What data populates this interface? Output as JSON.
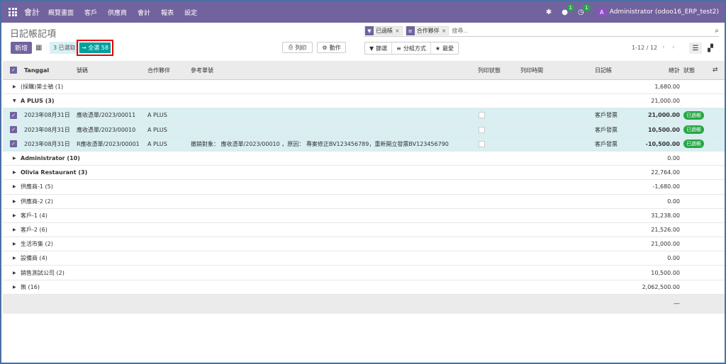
{
  "nav": {
    "brand": "會計",
    "items": [
      "概覽畫面",
      "客戶",
      "供應商",
      "會計",
      "報表",
      "設定"
    ],
    "chat_badge": "1",
    "activity_badge": "1",
    "avatar_letter": "A",
    "user": "Administrator (odoo16_ERP_test2)"
  },
  "page": {
    "title": "日記帳記項"
  },
  "search": {
    "facets": [
      {
        "icon": "filter-icon",
        "label": "已過帳"
      },
      {
        "icon": "layers-icon",
        "label": "合作夥伴"
      }
    ],
    "placeholder": "搜尋..."
  },
  "toolbar": {
    "new_label": "新增",
    "selected_label": "3 已選取",
    "select_all_label": "→ 全選 58",
    "print_label": "列印",
    "action_label": "動作",
    "filter_label": "篩選",
    "groupby_label": "分組方式",
    "favorites_label": "最愛",
    "pager": "1-12 / 12"
  },
  "columns": {
    "date": "Tanggal",
    "number": "號碼",
    "partner": "合作夥伴",
    "reference": "參考單號",
    "print_status": "列印狀態",
    "print_time": "列印時間",
    "journal": "日記帳",
    "total": "總計",
    "status": "狀態"
  },
  "groups_top": [
    {
      "label": "(採購)第士禎 (1)",
      "total": "1,680.00",
      "bold": false,
      "expanded": false
    },
    {
      "label": "A PLUS (3)",
      "total": "21,000.00",
      "bold": true,
      "expanded": true
    }
  ],
  "records": [
    {
      "date": "2023年08月31日",
      "number": "應收憑單/2023/00011",
      "partner": "A PLUS",
      "reference": "",
      "journal": "客戶發票",
      "total": "21,000.00",
      "status": "已過帳"
    },
    {
      "date": "2023年08月31日",
      "number": "應收憑單/2023/00010",
      "partner": "A PLUS",
      "reference": "",
      "journal": "客戶發票",
      "total": "10,500.00",
      "status": "已過帳"
    },
    {
      "date": "2023年08月31日",
      "number": "R應收憑單/2023/00001",
      "partner": "A PLUS",
      "reference": "撤銷對象： 應收憑單/2023/00010 ，原因： 專案修正BV123456789，重新開立發票BV123456790",
      "journal": "客戶發票",
      "total": "-10,500.00",
      "status": "已過帳"
    }
  ],
  "groups_bottom": [
    {
      "label": "Administrator (10)",
      "total": "0.00",
      "bold": true
    },
    {
      "label": "Olivia Restaurant (3)",
      "total": "22,764.00",
      "bold": true
    },
    {
      "label": "供應商-1 (5)",
      "total": "-1,680.00",
      "bold": false
    },
    {
      "label": "供應商-2 (2)",
      "total": "0.00",
      "bold": false
    },
    {
      "label": "客戶-1 (4)",
      "total": "31,238.00",
      "bold": false
    },
    {
      "label": "客戶-2 (6)",
      "total": "21,526.00",
      "bold": false
    },
    {
      "label": "生活市集 (2)",
      "total": "21,000.00",
      "bold": false
    },
    {
      "label": "設備商 (4)",
      "total": "0.00",
      "bold": false
    },
    {
      "label": "銷售測試公司 (2)",
      "total": "10,500.00",
      "bold": false
    },
    {
      "label": "無 (16)",
      "total": "2,062,500.00",
      "bold": false
    }
  ],
  "footer": {
    "total": "—"
  },
  "colors": {
    "brand": "#71639e",
    "teal": "#00a09d",
    "selected_row": "#d9eff1",
    "posted": "#28a745"
  }
}
